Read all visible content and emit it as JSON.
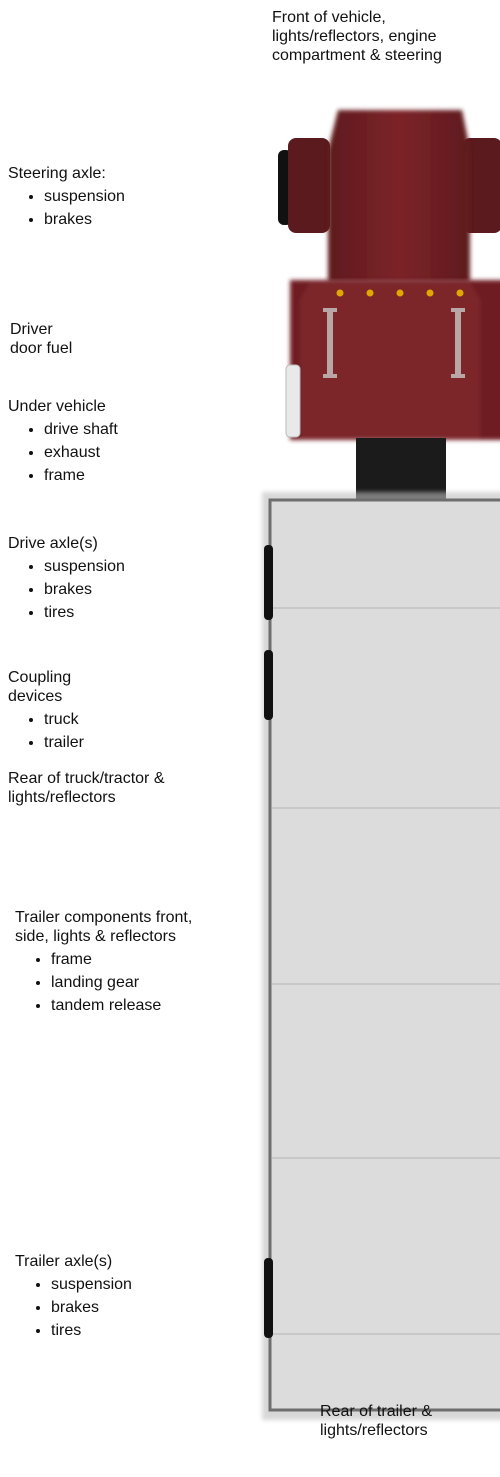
{
  "captions": {
    "front": "Front of vehicle, lights/reflectors, engine compartment & steering",
    "rear_trailer": "Rear of trailer & lights/reflectors"
  },
  "sections": {
    "steering": {
      "title": "Steering axle:",
      "items": [
        "suspension",
        "brakes"
      ]
    },
    "driver": {
      "title": "Driver door fuel"
    },
    "under": {
      "title": "Under vehicle",
      "items": [
        "drive shaft",
        "exhaust",
        "frame"
      ]
    },
    "drive": {
      "title": "Drive axle(s)",
      "items": [
        "suspension",
        "brakes",
        "tires"
      ]
    },
    "coupling": {
      "title": "Coupling devices",
      "items": [
        "truck",
        "trailer"
      ]
    },
    "rear_truck": {
      "title": "Rear of truck/tractor & lights/reflectors"
    },
    "trailer_components": {
      "title": "Trailer components front, side, lights & reflectors",
      "items": [
        "frame",
        "landing gear",
        "tandem release"
      ]
    },
    "trailer_axle": {
      "title": "Trailer axle(s)",
      "items": [
        "suspension",
        "brakes",
        "tires"
      ]
    }
  },
  "colors": {
    "cab": "#7a2226",
    "cab_dark": "#4a1216",
    "trailer": "#dcdcdc",
    "trailer_border": "#6e6e6e",
    "wheel": "#111111",
    "marker_light": "#e0a800"
  }
}
